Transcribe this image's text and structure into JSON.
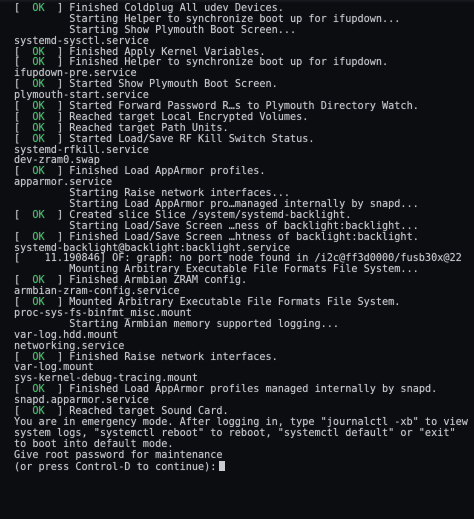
{
  "theme": {
    "text": "#c9cbd0",
    "ok": "#3fc467",
    "background": "#0c0d11"
  },
  "console": {
    "lines": [
      {
        "status": "OK",
        "text": " Finished Coldplug All udev Devices."
      },
      {
        "text": "         Starting Helper to synchronize boot up for ifupdown..."
      },
      {
        "text": "         Starting Show Plymouth Boot Screen..."
      },
      {
        "text": "systemd-sysctl.service"
      },
      {
        "status": "OK",
        "text": " Finished Apply Kernel Variables."
      },
      {
        "status": "OK",
        "text": " Finished Helper to synchronize boot up for ifupdown."
      },
      {
        "text": "ifupdown-pre.service"
      },
      {
        "status": "OK",
        "text": " Started Show Plymouth Boot Screen."
      },
      {
        "text": "plymouth-start.service"
      },
      {
        "status": "OK",
        "text": " Started Forward Password R…s to Plymouth Directory Watch."
      },
      {
        "status": "OK",
        "text": " Reached target Local Encrypted Volumes."
      },
      {
        "status": "OK",
        "text": " Reached target Path Units."
      },
      {
        "status": "OK",
        "text": " Started Load/Save RF Kill Switch Status."
      },
      {
        "text": "systemd-rfkill.service"
      },
      {
        "text": "dev-zram0.swap"
      },
      {
        "status": "OK",
        "text": " Finished Load AppArmor profiles."
      },
      {
        "text": "apparmor.service"
      },
      {
        "text": "         Starting Raise network interfaces..."
      },
      {
        "text": "         Starting Load AppArmor pro…managed internally by snapd..."
      },
      {
        "status": "OK",
        "text": " Created slice Slice /system/systemd-backlight."
      },
      {
        "text": "         Starting Load/Save Screen …ness of backlight:backlight..."
      },
      {
        "status": "OK",
        "text": " Finished Load/Save Screen …htness of backlight:backlight."
      },
      {
        "text": "systemd-backlight@backlight:backlight.service"
      },
      {
        "text": "[    11.190846] OF: graph: no port node found in /i2c@ff3d0000/fusb30x@22"
      },
      {
        "text": "         Mounting Arbitrary Executable File Formats File System..."
      },
      {
        "status": "OK",
        "text": " Finished Armbian ZRAM config."
      },
      {
        "text": "armbian-zram-config.service"
      },
      {
        "status": "OK",
        "text": " Mounted Arbitrary Executable File Formats File System."
      },
      {
        "text": "proc-sys-fs-binfmt_misc.mount"
      },
      {
        "text": "         Starting Armbian memory supported logging..."
      },
      {
        "text": "var-log.hdd.mount"
      },
      {
        "text": "networking.service"
      },
      {
        "status": "OK",
        "text": " Finished Raise network interfaces."
      },
      {
        "text": "var-log.mount"
      },
      {
        "text": "sys-kernel-debug-tracing.mount"
      },
      {
        "status": "OK",
        "text": " Finished Load AppArmor profiles managed internally by snapd."
      },
      {
        "text": "snapd.apparmor.service"
      },
      {
        "status": "OK",
        "text": " Reached target Sound Card."
      },
      {
        "text": "You are in emergency mode. After logging in, type \"journalctl -xb\" to view"
      },
      {
        "text": "system logs, \"systemctl reboot\" to reboot, \"systemctl default\" or \"exit\""
      },
      {
        "text": "to boot into default mode."
      },
      {
        "text": "Give root password for maintenance"
      },
      {
        "text": "(or press Control-D to continue):"
      }
    ]
  }
}
